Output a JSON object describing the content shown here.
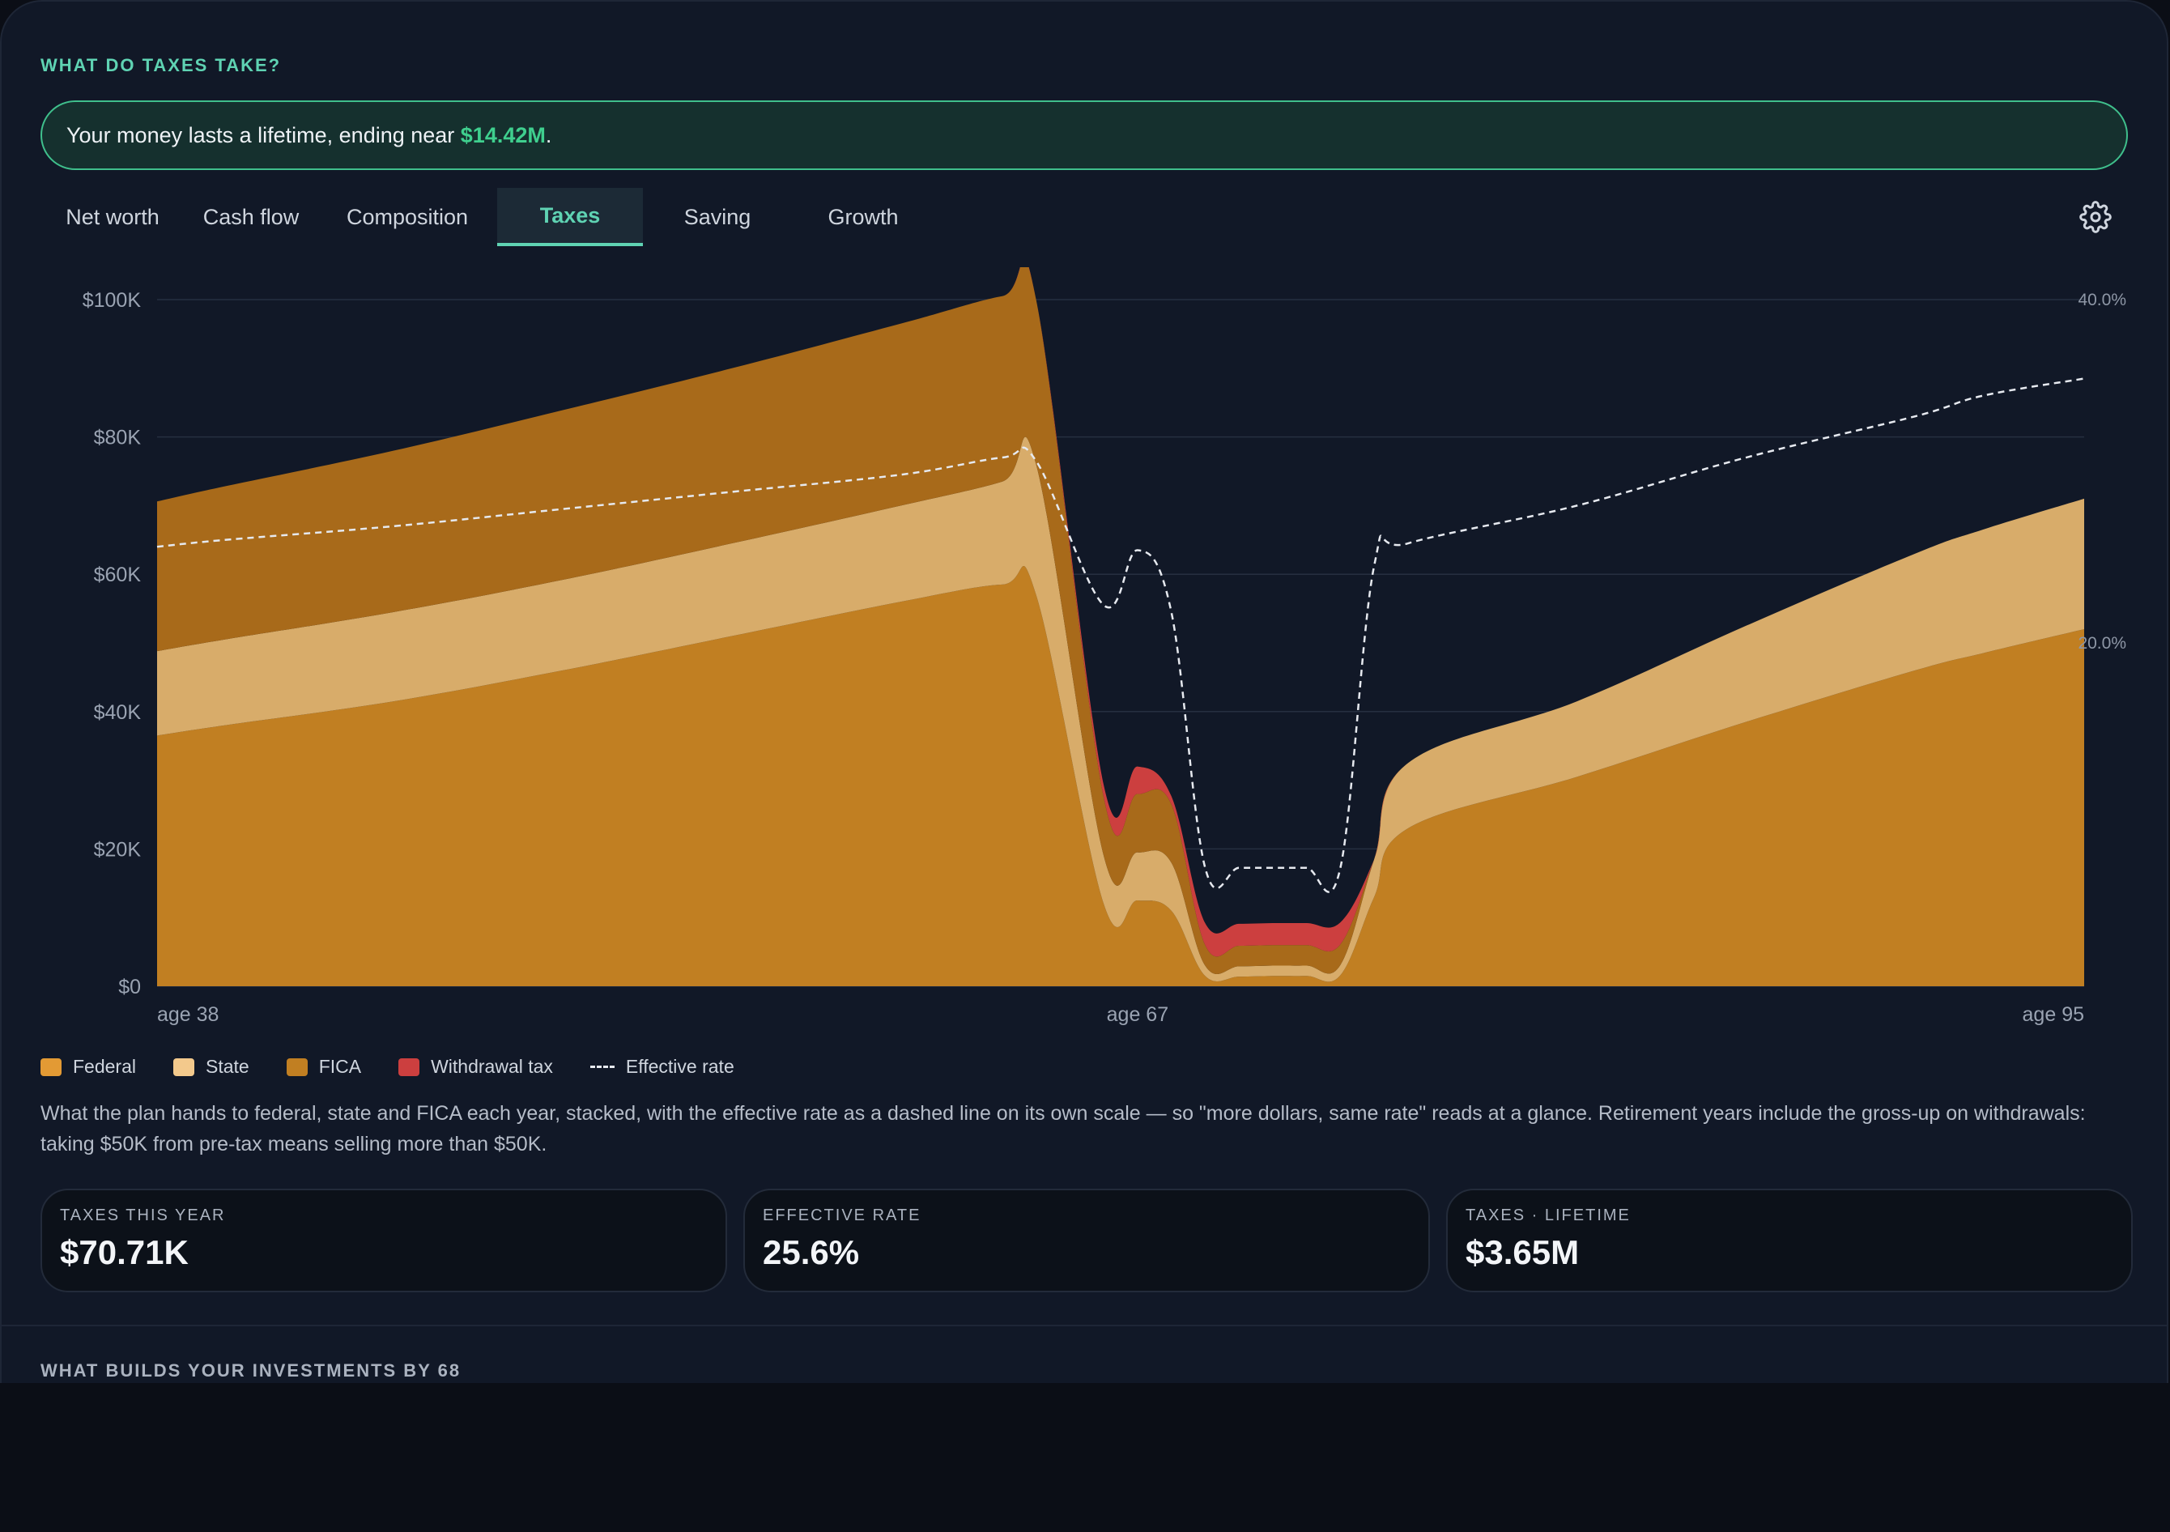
{
  "section_title": "WHAT DO TAXES TAKE?",
  "banner": {
    "prefix": "Your money lasts a lifetime, ending near ",
    "highlight": "$14.42M",
    "suffix": "."
  },
  "tabs": [
    {
      "label": "Net worth"
    },
    {
      "label": "Cash flow"
    },
    {
      "label": "Composition"
    },
    {
      "label": "Taxes",
      "active": true
    },
    {
      "label": "Saving"
    },
    {
      "label": "Growth"
    }
  ],
  "settings_icon": "gear-icon",
  "chart_data": {
    "type": "area",
    "stacked": true,
    "x": [
      38,
      40,
      45,
      50,
      55,
      60,
      63,
      64,
      66,
      67,
      68,
      69,
      70,
      71,
      72,
      73,
      74,
      75,
      80,
      85,
      90,
      92,
      95
    ],
    "x_tick_labels": [
      "age 38",
      "age 67",
      "age 95"
    ],
    "y_tick_labels": [
      "$0",
      "$20K",
      "$40K",
      "$60K",
      "$80K",
      "$100K"
    ],
    "ylim": [
      0,
      100000
    ],
    "y2_tick_labels": [
      "20.0%",
      "40.0%"
    ],
    "y2lim": [
      0,
      40
    ],
    "series": [
      {
        "name": "Federal",
        "color": "#c17f22",
        "values": [
          36500,
          38000,
          41500,
          46000,
          51000,
          56000,
          58500,
          57000,
          12000,
          12500,
          11000,
          1500,
          1400,
          1500,
          1500,
          1600,
          13000,
          23000,
          30500,
          38500,
          46000,
          48500,
          52000
        ]
      },
      {
        "name": "State",
        "color": "#d8ac6a",
        "values": [
          12300,
          12500,
          13000,
          13200,
          13500,
          14000,
          15000,
          19000,
          7000,
          7000,
          7000,
          1500,
          1500,
          1500,
          1500,
          1500,
          5500,
          9500,
          11000,
          14000,
          17000,
          18000,
          19000
        ]
      },
      {
        "name": "FICA",
        "color": "#a86a1a",
        "values": [
          21800,
          22300,
          23500,
          24700,
          25500,
          26500,
          27000,
          24000,
          8500,
          8500,
          8500,
          3000,
          3000,
          3000,
          3000,
          3000,
          0,
          0,
          0,
          0,
          0,
          0,
          0
        ]
      },
      {
        "name": "Withdrawal tax",
        "color": "#cc3f3f",
        "values": [
          0,
          0,
          0,
          0,
          0,
          0,
          0,
          0,
          1800,
          4000,
          1200,
          3200,
          3200,
          3200,
          3200,
          3200,
          0,
          0,
          0,
          0,
          0,
          0,
          0
        ]
      }
    ],
    "effective_rate": {
      "name": "Effective rate",
      "color": "#e6e9ef",
      "values": [
        25.6,
        26,
        26.8,
        27.8,
        28.8,
        29.8,
        30.8,
        30.6,
        22.2,
        25.4,
        21.8,
        6.9,
        6.9,
        6.9,
        6.9,
        6.9,
        24.5,
        25.8,
        28,
        30.8,
        33.2,
        34.4,
        35.4
      ]
    },
    "xlabel": "",
    "ylabel": "",
    "grid": true,
    "legend": "bottom-left"
  },
  "legend": [
    {
      "label": "Federal",
      "color": "#e39a34"
    },
    {
      "label": "State",
      "color": "#f3c98c"
    },
    {
      "label": "FICA",
      "color": "#c17f22"
    },
    {
      "label": "Withdrawal tax",
      "color": "#cc3f3f"
    },
    {
      "label": "Effective rate",
      "dashed": true
    }
  ],
  "description": "What the plan hands to federal, state and FICA each year, stacked, with the effective rate as a dashed line on its own scale — so \"more dollars, same rate\" reads at a glance. Retirement years include the gross-up on withdrawals: taking $50K from pre-tax means selling more than $50K.",
  "cards": [
    {
      "label": "TAXES THIS YEAR",
      "value": "$70.71K"
    },
    {
      "label": "EFFECTIVE RATE",
      "value": "25.6%"
    },
    {
      "label": "TAXES · LIFETIME",
      "value": "$3.65M"
    }
  ],
  "next_section_title": "WHAT BUILDS YOUR INVESTMENTS BY 68"
}
